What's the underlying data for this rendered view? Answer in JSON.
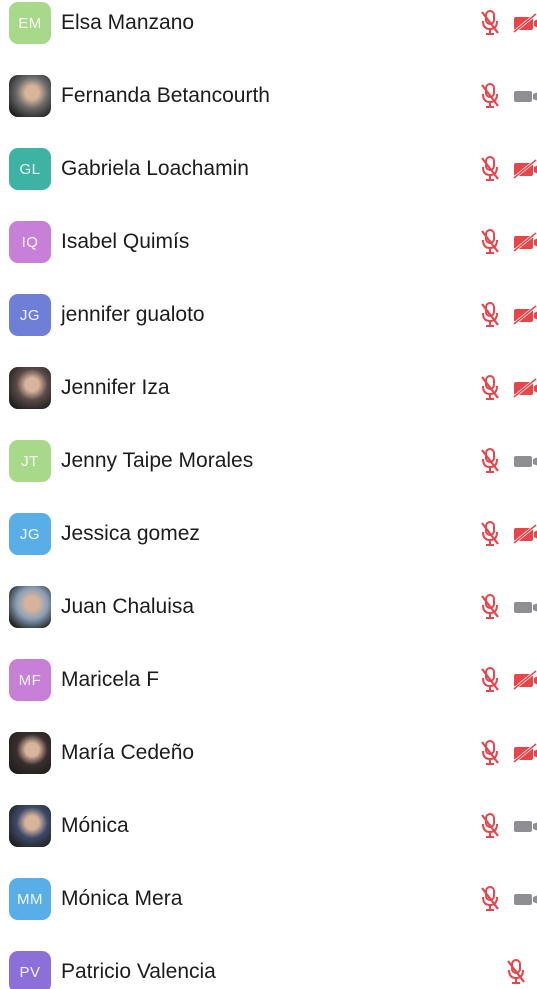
{
  "participants": [
    {
      "initials": "EM",
      "name": "Elsa Manzano",
      "avatar_color": "#a8d88a",
      "photo": false,
      "mic": "muted",
      "video": "off-red"
    },
    {
      "initials": "",
      "name": "Fernanda Betancourth",
      "avatar_color": "#6b6b6b",
      "photo": true,
      "mic": "muted",
      "video": "off-gray"
    },
    {
      "initials": "GL",
      "name": "Gabriela Loachamin",
      "avatar_color": "#3fb3a3",
      "photo": false,
      "mic": "muted",
      "video": "off-red"
    },
    {
      "initials": "IQ",
      "name": "Isabel Quimís",
      "avatar_color": "#c77fd8",
      "photo": false,
      "mic": "muted",
      "video": "off-red"
    },
    {
      "initials": "JG",
      "name": "jennifer gualoto",
      "avatar_color": "#6f7fd8",
      "photo": false,
      "mic": "muted",
      "video": "off-red"
    },
    {
      "initials": "",
      "name": "Jennifer Iza",
      "avatar_color": "#5a4a48",
      "photo": true,
      "mic": "muted",
      "video": "off-red"
    },
    {
      "initials": "JT",
      "name": "Jenny Taipe Morales",
      "avatar_color": "#a8d88a",
      "photo": false,
      "mic": "muted",
      "video": "off-gray"
    },
    {
      "initials": "JG",
      "name": "Jessica gomez",
      "avatar_color": "#5aaee8",
      "photo": false,
      "mic": "muted",
      "video": "off-red"
    },
    {
      "initials": "",
      "name": "Juan Chaluisa",
      "avatar_color": "#8aa0b8",
      "photo": true,
      "mic": "muted",
      "video": "off-gray"
    },
    {
      "initials": "MF",
      "name": "Maricela F",
      "avatar_color": "#c77fd8",
      "photo": false,
      "mic": "muted",
      "video": "off-red"
    },
    {
      "initials": "",
      "name": "María Cedeño",
      "avatar_color": "#3a2e2e",
      "photo": true,
      "mic": "muted",
      "video": "off-red"
    },
    {
      "initials": "",
      "name": "Mónica",
      "avatar_color": "#3d4a6a",
      "photo": true,
      "mic": "muted",
      "video": "off-gray"
    },
    {
      "initials": "MM",
      "name": "Mónica Mera",
      "avatar_color": "#5aaee8",
      "photo": false,
      "mic": "muted",
      "video": "off-gray"
    },
    {
      "initials": "PV",
      "name": "Patricio Valencia",
      "avatar_color": "#8c6fd8",
      "photo": false,
      "mic": "muted",
      "video": "none"
    }
  ],
  "colors": {
    "muted_red": "#e8454a",
    "video_gray": "#8e8e93"
  },
  "icons": {
    "mic": "mic-muted-icon",
    "video_off": "video-off-icon",
    "video_gray": "video-icon"
  }
}
